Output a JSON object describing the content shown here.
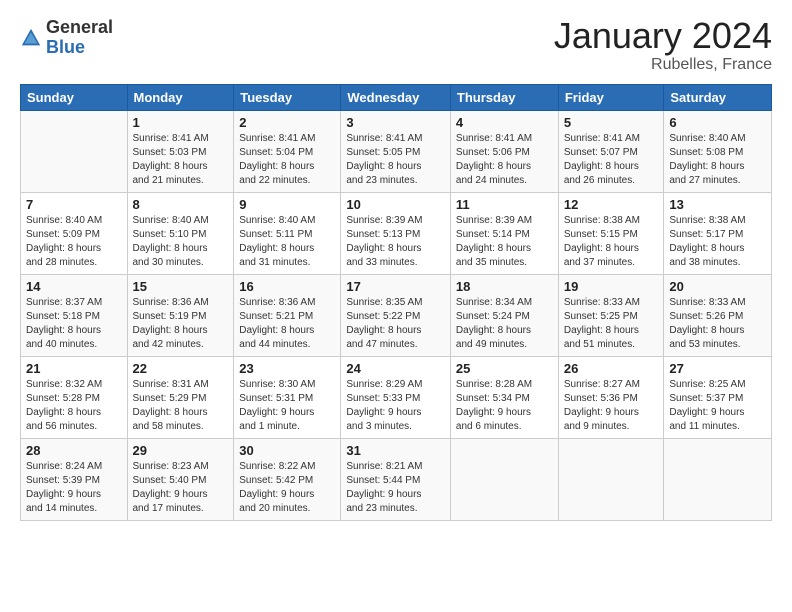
{
  "logo": {
    "general": "General",
    "blue": "Blue"
  },
  "title": "January 2024",
  "subtitle": "Rubelles, France",
  "days_header": [
    "Sunday",
    "Monday",
    "Tuesday",
    "Wednesday",
    "Thursday",
    "Friday",
    "Saturday"
  ],
  "weeks": [
    [
      {
        "num": "",
        "info": ""
      },
      {
        "num": "1",
        "info": "Sunrise: 8:41 AM\nSunset: 5:03 PM\nDaylight: 8 hours\nand 21 minutes."
      },
      {
        "num": "2",
        "info": "Sunrise: 8:41 AM\nSunset: 5:04 PM\nDaylight: 8 hours\nand 22 minutes."
      },
      {
        "num": "3",
        "info": "Sunrise: 8:41 AM\nSunset: 5:05 PM\nDaylight: 8 hours\nand 23 minutes."
      },
      {
        "num": "4",
        "info": "Sunrise: 8:41 AM\nSunset: 5:06 PM\nDaylight: 8 hours\nand 24 minutes."
      },
      {
        "num": "5",
        "info": "Sunrise: 8:41 AM\nSunset: 5:07 PM\nDaylight: 8 hours\nand 26 minutes."
      },
      {
        "num": "6",
        "info": "Sunrise: 8:40 AM\nSunset: 5:08 PM\nDaylight: 8 hours\nand 27 minutes."
      }
    ],
    [
      {
        "num": "7",
        "info": "Sunrise: 8:40 AM\nSunset: 5:09 PM\nDaylight: 8 hours\nand 28 minutes."
      },
      {
        "num": "8",
        "info": "Sunrise: 8:40 AM\nSunset: 5:10 PM\nDaylight: 8 hours\nand 30 minutes."
      },
      {
        "num": "9",
        "info": "Sunrise: 8:40 AM\nSunset: 5:11 PM\nDaylight: 8 hours\nand 31 minutes."
      },
      {
        "num": "10",
        "info": "Sunrise: 8:39 AM\nSunset: 5:13 PM\nDaylight: 8 hours\nand 33 minutes."
      },
      {
        "num": "11",
        "info": "Sunrise: 8:39 AM\nSunset: 5:14 PM\nDaylight: 8 hours\nand 35 minutes."
      },
      {
        "num": "12",
        "info": "Sunrise: 8:38 AM\nSunset: 5:15 PM\nDaylight: 8 hours\nand 37 minutes."
      },
      {
        "num": "13",
        "info": "Sunrise: 8:38 AM\nSunset: 5:17 PM\nDaylight: 8 hours\nand 38 minutes."
      }
    ],
    [
      {
        "num": "14",
        "info": "Sunrise: 8:37 AM\nSunset: 5:18 PM\nDaylight: 8 hours\nand 40 minutes."
      },
      {
        "num": "15",
        "info": "Sunrise: 8:36 AM\nSunset: 5:19 PM\nDaylight: 8 hours\nand 42 minutes."
      },
      {
        "num": "16",
        "info": "Sunrise: 8:36 AM\nSunset: 5:21 PM\nDaylight: 8 hours\nand 44 minutes."
      },
      {
        "num": "17",
        "info": "Sunrise: 8:35 AM\nSunset: 5:22 PM\nDaylight: 8 hours\nand 47 minutes."
      },
      {
        "num": "18",
        "info": "Sunrise: 8:34 AM\nSunset: 5:24 PM\nDaylight: 8 hours\nand 49 minutes."
      },
      {
        "num": "19",
        "info": "Sunrise: 8:33 AM\nSunset: 5:25 PM\nDaylight: 8 hours\nand 51 minutes."
      },
      {
        "num": "20",
        "info": "Sunrise: 8:33 AM\nSunset: 5:26 PM\nDaylight: 8 hours\nand 53 minutes."
      }
    ],
    [
      {
        "num": "21",
        "info": "Sunrise: 8:32 AM\nSunset: 5:28 PM\nDaylight: 8 hours\nand 56 minutes."
      },
      {
        "num": "22",
        "info": "Sunrise: 8:31 AM\nSunset: 5:29 PM\nDaylight: 8 hours\nand 58 minutes."
      },
      {
        "num": "23",
        "info": "Sunrise: 8:30 AM\nSunset: 5:31 PM\nDaylight: 9 hours\nand 1 minute."
      },
      {
        "num": "24",
        "info": "Sunrise: 8:29 AM\nSunset: 5:33 PM\nDaylight: 9 hours\nand 3 minutes."
      },
      {
        "num": "25",
        "info": "Sunrise: 8:28 AM\nSunset: 5:34 PM\nDaylight: 9 hours\nand 6 minutes."
      },
      {
        "num": "26",
        "info": "Sunrise: 8:27 AM\nSunset: 5:36 PM\nDaylight: 9 hours\nand 9 minutes."
      },
      {
        "num": "27",
        "info": "Sunrise: 8:25 AM\nSunset: 5:37 PM\nDaylight: 9 hours\nand 11 minutes."
      }
    ],
    [
      {
        "num": "28",
        "info": "Sunrise: 8:24 AM\nSunset: 5:39 PM\nDaylight: 9 hours\nand 14 minutes."
      },
      {
        "num": "29",
        "info": "Sunrise: 8:23 AM\nSunset: 5:40 PM\nDaylight: 9 hours\nand 17 minutes."
      },
      {
        "num": "30",
        "info": "Sunrise: 8:22 AM\nSunset: 5:42 PM\nDaylight: 9 hours\nand 20 minutes."
      },
      {
        "num": "31",
        "info": "Sunrise: 8:21 AM\nSunset: 5:44 PM\nDaylight: 9 hours\nand 23 minutes."
      },
      {
        "num": "",
        "info": ""
      },
      {
        "num": "",
        "info": ""
      },
      {
        "num": "",
        "info": ""
      }
    ]
  ]
}
